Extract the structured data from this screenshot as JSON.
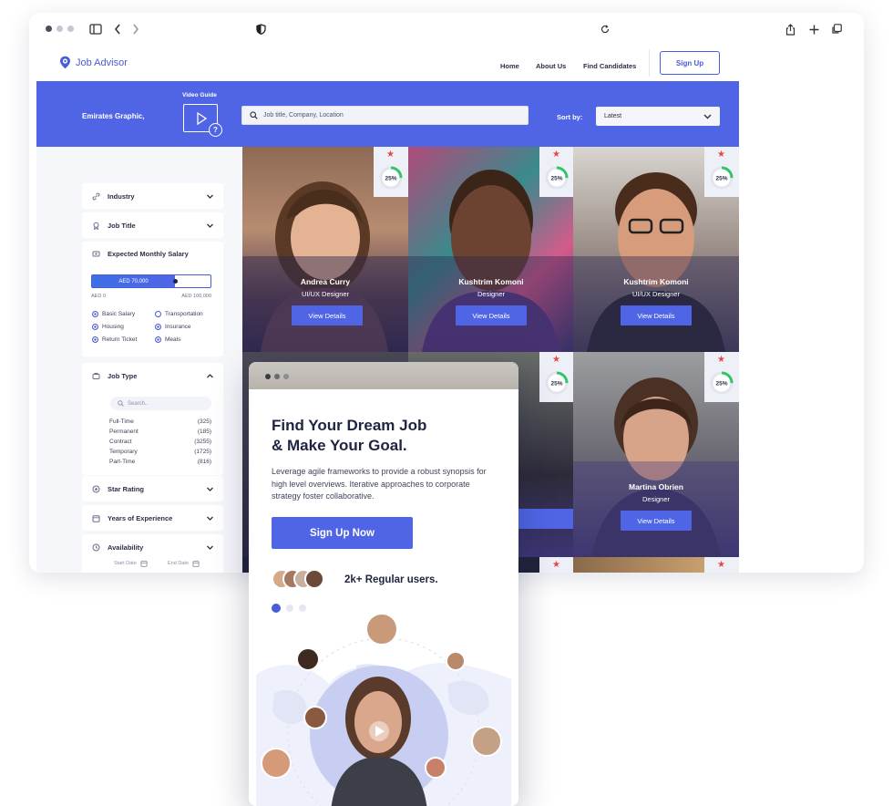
{
  "app": {
    "logo_text": "Job Advisor",
    "nav": [
      "Home",
      "About Us",
      "Find Candidates"
    ],
    "signup_label": "Sign Up"
  },
  "banner": {
    "company": "Emirates Graphic,",
    "video_guide": "Video Guide",
    "search_placeholder": "Job title, Company, Location",
    "sort_label": "Sort by:",
    "sort_value": "Latest"
  },
  "filters": {
    "industry": "Industry",
    "job_title": "Job Title",
    "salary": {
      "title": "Expected Monthly Salary",
      "value_label": "AED 70,000",
      "value_fraction": 0.7,
      "min": "AED 0",
      "max": "AED 100,000",
      "benefits": [
        {
          "label": "Basic Salary",
          "checked": true
        },
        {
          "label": "Transportation",
          "checked": false
        },
        {
          "label": "Housing",
          "checked": true
        },
        {
          "label": "Insurance",
          "checked": true
        },
        {
          "label": "Return Ticket",
          "checked": true
        },
        {
          "label": "Meals",
          "checked": true
        }
      ]
    },
    "job_type": {
      "title": "Job Type",
      "search_placeholder": "Search..",
      "items": [
        {
          "label": "Full-Time",
          "count": "(325)"
        },
        {
          "label": "Permanent",
          "count": "(185)"
        },
        {
          "label": "Contract",
          "count": "(3255)"
        },
        {
          "label": "Temporary",
          "count": "(1725)"
        },
        {
          "label": "Part-Time",
          "count": "(816)"
        }
      ]
    },
    "star_rating": "Star Rating",
    "years_experience": "Years of Experience",
    "availability": {
      "title": "Availability",
      "start": "Start Date",
      "end": "End Date"
    }
  },
  "candidates": [
    {
      "name": "Andrea Curry",
      "role": "UI/UX Designer",
      "match": "25%",
      "button": "View Details"
    },
    {
      "name": "Kushtrim Komoni",
      "role": "Designer",
      "match": "25%",
      "button": "View Details"
    },
    {
      "name": "Kushtrim Komoni",
      "role": "UI/UX Designer",
      "match": "25%",
      "button": "View Details"
    },
    {
      "match": "25%"
    },
    {
      "name": "Martina Obrien",
      "role": "Designer",
      "match": "25%",
      "button": "View Details"
    }
  ],
  "phone": {
    "title_line1": "Find Your Dream Job",
    "title_line2": "& Make Your Goal.",
    "text": "Leverage agile frameworks to provide a robust synopsis for high level overviews. Iterative approaches to corporate strategy foster collaborative.",
    "cta": "Sign Up Now",
    "users_text": "2k+ Regular users."
  },
  "colors": {
    "accent": "#5065e6",
    "star": "#e84646",
    "progress": "#33c46b"
  }
}
